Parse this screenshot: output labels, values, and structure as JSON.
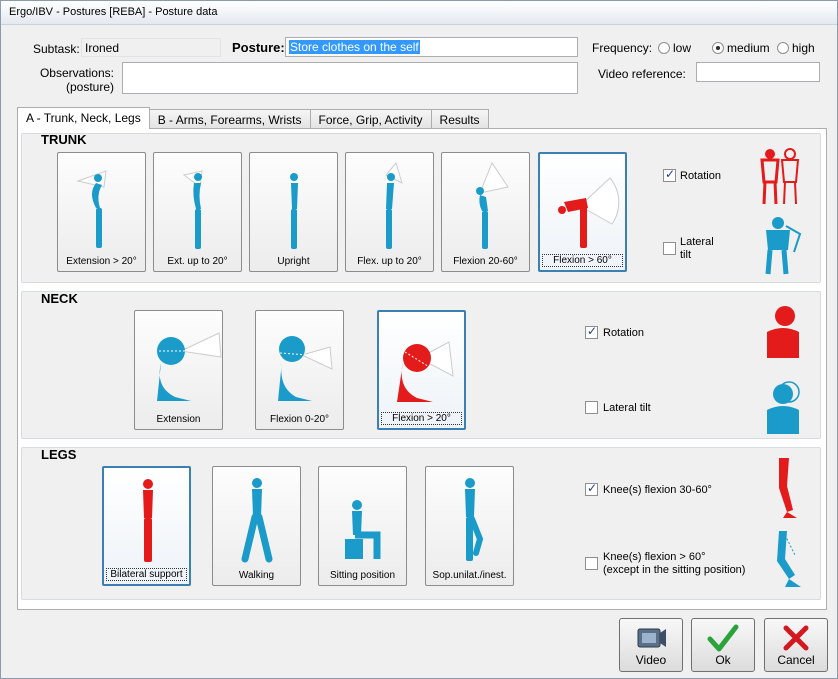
{
  "window": {
    "title": "Ergo/IBV - Postures [REBA] - Posture data"
  },
  "header": {
    "subtask_label": "Subtask:",
    "subtask_value": "Ironed",
    "posture_label": "Posture:",
    "posture_value": "Store clothes on the self",
    "observations_label_1": "Observations:",
    "observations_label_2": "(posture)",
    "observations_value": "",
    "frequency_label": "Frequency:",
    "frequency_options": [
      "low",
      "medium",
      "high"
    ],
    "frequency_selected": "medium",
    "video_ref_label": "Video reference:",
    "video_ref_value": ""
  },
  "tabs": [
    {
      "label": "A - Trunk, Neck, Legs",
      "active": true
    },
    {
      "label": "B - Arms, Forearms, Wrists",
      "active": false
    },
    {
      "label": "Force, Grip, Activity",
      "active": false
    },
    {
      "label": "Results",
      "active": false
    }
  ],
  "trunk": {
    "title": "TRUNK",
    "cards": [
      {
        "label": "Extension > 20°",
        "selected": false
      },
      {
        "label": "Ext. up to 20°",
        "selected": false
      },
      {
        "label": "Upright",
        "selected": false
      },
      {
        "label": "Flex. up to 20°",
        "selected": false
      },
      {
        "label": "Flexion 20-60°",
        "selected": false
      },
      {
        "label": "Flexion > 60°",
        "selected": true
      }
    ],
    "rotation_label": "Rotation",
    "rotation_checked": true,
    "lateral_label_1": "Lateral",
    "lateral_label_2": "tilt",
    "lateral_checked": false
  },
  "neck": {
    "title": "NECK",
    "cards": [
      {
        "label": "Extension",
        "selected": false
      },
      {
        "label": "Flexion 0-20°",
        "selected": false
      },
      {
        "label": "Flexion > 20°",
        "selected": true
      }
    ],
    "rotation_label": "Rotation",
    "rotation_checked": true,
    "lateral_label": "Lateral tilt",
    "lateral_checked": false
  },
  "legs": {
    "title": "LEGS",
    "cards": [
      {
        "label": "Bilateral support",
        "selected": true
      },
      {
        "label": "Walking",
        "selected": false
      },
      {
        "label": "Sitting position",
        "selected": false
      },
      {
        "label": "Sop.unilat./inest.",
        "selected": false
      }
    ],
    "knee30_label": "Knee(s) flexion 30-60°",
    "knee30_checked": true,
    "knee60_label_1": "Knee(s) flexion > 60°",
    "knee60_label_2": "(except in the sitting position)",
    "knee60_checked": false
  },
  "buttons": {
    "video": "Video",
    "ok": "Ok",
    "cancel": "Cancel"
  },
  "colors": {
    "blue_figure": "#1a9bc9",
    "red_figure": "#e41b1b",
    "selection": "#3399ff"
  }
}
